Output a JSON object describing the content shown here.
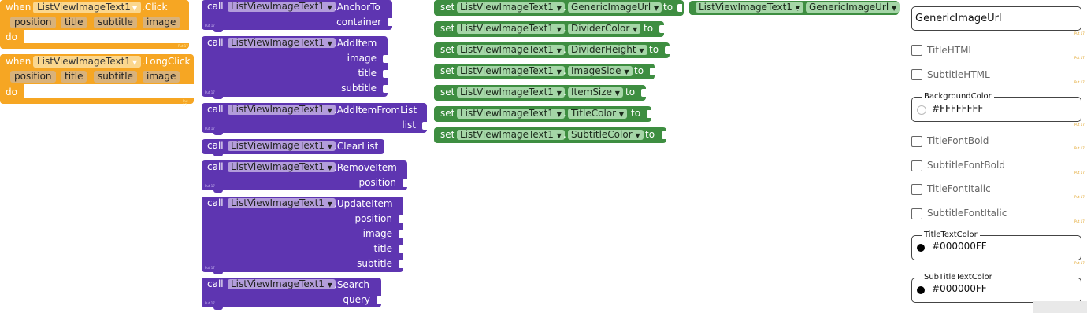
{
  "events": [
    {
      "keyword_when": "when",
      "component": "ListViewImageText1",
      "event": ".Click",
      "params": [
        "position",
        "title",
        "subtitle",
        "image"
      ],
      "keyword_do": "do",
      "tag": "Put 17"
    },
    {
      "keyword_when": "when",
      "component": "ListViewImageText1",
      "event": ".LongClick",
      "params": [
        "position",
        "title",
        "subtitle",
        "image"
      ],
      "keyword_do": "do",
      "tag": "Put 17"
    }
  ],
  "methods": [
    {
      "keyword": "call",
      "component": "ListViewImageText1",
      "method": ".AnchorTo",
      "args": [
        "container"
      ],
      "tag": "Put 17"
    },
    {
      "keyword": "call",
      "component": "ListViewImageText1",
      "method": ".AddItem",
      "args": [
        "image",
        "title",
        "subtitle"
      ],
      "tag": "Put 17"
    },
    {
      "keyword": "call",
      "component": "ListViewImageText1",
      "method": ".AddItemFromList",
      "args": [
        "list"
      ],
      "tag": "Put 17"
    },
    {
      "keyword": "call",
      "component": "ListViewImageText1",
      "method": ".ClearList",
      "args": [],
      "tag": "Put 17"
    },
    {
      "keyword": "call",
      "component": "ListViewImageText1",
      "method": ".RemoveItem",
      "args": [
        "position"
      ],
      "tag": "Put 17"
    },
    {
      "keyword": "call",
      "component": "ListViewImageText1",
      "method": ".UpdateItem",
      "args": [
        "position",
        "image",
        "title",
        "subtitle"
      ],
      "tag": "Put 17"
    },
    {
      "keyword": "call",
      "component": "ListViewImageText1",
      "method": ".Search",
      "args": [
        "query"
      ],
      "tag": "Put 17"
    }
  ],
  "setters": [
    {
      "keyword": "set",
      "component": "ListViewImageText1",
      "dot": ".",
      "property": "GenericImageUrl",
      "to": "to"
    },
    {
      "keyword": "set",
      "component": "ListViewImageText1",
      "dot": ".",
      "property": "DividerColor",
      "to": "to"
    },
    {
      "keyword": "set",
      "component": "ListViewImageText1",
      "dot": ".",
      "property": "DividerHeight",
      "to": "to"
    },
    {
      "keyword": "set",
      "component": "ListViewImageText1",
      "dot": ".",
      "property": "ImageSide",
      "to": "to"
    },
    {
      "keyword": "set",
      "component": "ListViewImageText1",
      "dot": ".",
      "property": "ItemSize",
      "to": "to"
    },
    {
      "keyword": "set",
      "component": "ListViewImageText1",
      "dot": ".",
      "property": "TitleColor",
      "to": "to"
    },
    {
      "keyword": "set",
      "component": "ListViewImageText1",
      "dot": ".",
      "property": "SubtitleColor",
      "to": "to"
    }
  ],
  "getter": {
    "component": "ListViewImageText1",
    "dot": ".",
    "property": "GenericImageUrl"
  },
  "panel": {
    "generic_image_url": {
      "value": "GenericImageUrl"
    },
    "title_html": {
      "label": "TitleHTML",
      "checked": false
    },
    "subtitle_html": {
      "label": "SubtitleHTML",
      "checked": false
    },
    "background_color": {
      "label": "BackgroundColor",
      "value": "#FFFFFFFF",
      "swatch": "#ffffff"
    },
    "title_font_bold": {
      "label": "TitleFontBold",
      "checked": false
    },
    "subtitle_font_bold": {
      "label": "SubtitleFontBold",
      "checked": false
    },
    "title_font_italic": {
      "label": "TitleFontItalic",
      "checked": false
    },
    "subtitle_font_italic": {
      "label": "SubtitleFontItalic",
      "checked": false
    },
    "title_text_color": {
      "label": "TitleTextColor",
      "value": "#000000FF",
      "swatch": "#000000"
    },
    "subtitle_text_color": {
      "label": "SubTitleTextColor",
      "value": "#000000FF",
      "swatch": "#000000"
    },
    "mini_tag": "Put 17"
  },
  "colors": {
    "event": "#F6A623",
    "method": "#5E35B1",
    "setter": "#3E8E41"
  }
}
